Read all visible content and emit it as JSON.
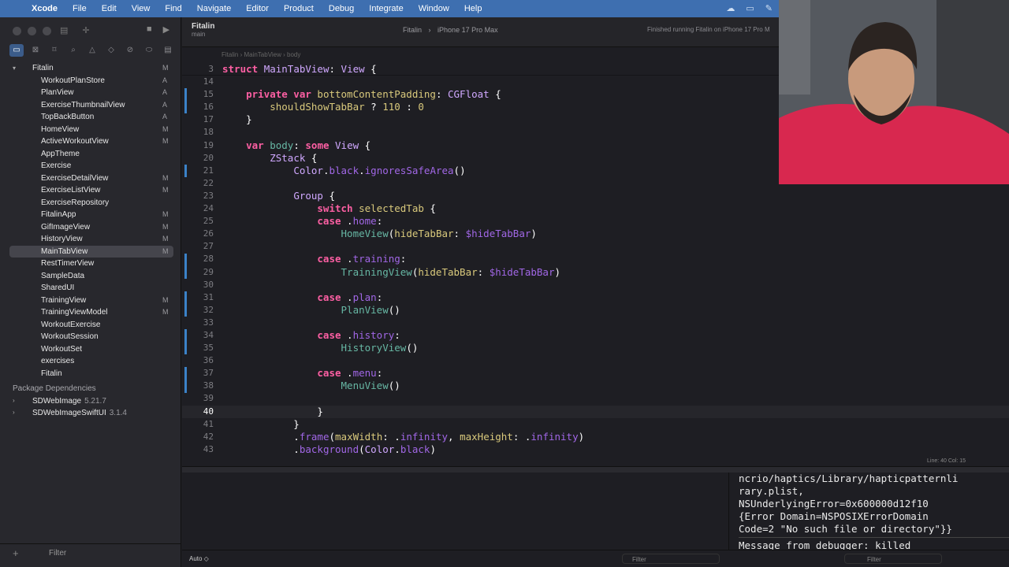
{
  "menubar": {
    "app": "Xcode",
    "items": [
      "File",
      "Edit",
      "View",
      "Find",
      "Navigate",
      "Editor",
      "Product",
      "Debug",
      "Integrate",
      "Window",
      "Help"
    ]
  },
  "toolbar": {
    "project": "Fitalin",
    "branch": "main",
    "scheme": "Fitalin",
    "destination": "iPhone 17 Pro Max",
    "status": "Finished running Fitalin on iPhone 17 Pro M"
  },
  "breadcrumb": [
    "Fitalin",
    "MainTabView",
    "body"
  ],
  "navigator": {
    "root": "Fitalin",
    "root_status": "M",
    "files": [
      {
        "name": "WorkoutPlanStore",
        "status": "A"
      },
      {
        "name": "PlanView",
        "status": "A"
      },
      {
        "name": "ExerciseThumbnailView",
        "status": "A"
      },
      {
        "name": "TopBackButton",
        "status": "A"
      },
      {
        "name": "HomeView",
        "status": "M"
      },
      {
        "name": "ActiveWorkoutView",
        "status": "M"
      },
      {
        "name": "AppTheme",
        "status": ""
      },
      {
        "name": "Exercise",
        "status": ""
      },
      {
        "name": "ExerciseDetailView",
        "status": "M"
      },
      {
        "name": "ExerciseListView",
        "status": "M"
      },
      {
        "name": "ExerciseRepository",
        "status": ""
      },
      {
        "name": "FitalinApp",
        "status": "M"
      },
      {
        "name": "GifImageView",
        "status": "M"
      },
      {
        "name": "HistoryView",
        "status": "M"
      },
      {
        "name": "MainTabView",
        "status": "M"
      },
      {
        "name": "RestTimerView",
        "status": ""
      },
      {
        "name": "SampleData",
        "status": ""
      },
      {
        "name": "SharedUI",
        "status": ""
      },
      {
        "name": "TrainingView",
        "status": "M"
      },
      {
        "name": "TrainingViewModel",
        "status": "M"
      },
      {
        "name": "WorkoutExercise",
        "status": ""
      },
      {
        "name": "WorkoutSession",
        "status": ""
      },
      {
        "name": "WorkoutSet",
        "status": ""
      },
      {
        "name": "exercises",
        "status": ""
      },
      {
        "name": "Fitalin",
        "status": ""
      }
    ],
    "packages_header": "Package Dependencies",
    "packages": [
      {
        "name": "SDWebImage",
        "version": "5.21.7"
      },
      {
        "name": "SDWebImageSwiftUI",
        "version": "3.1.4"
      }
    ],
    "filter_placeholder": "Filter"
  },
  "editor": {
    "sticky": {
      "num": "3",
      "parts": [
        [
          "kw",
          "struct "
        ],
        [
          "ty",
          "MainTabView"
        ],
        [
          "pl",
          ": "
        ],
        [
          "ty",
          "View"
        ],
        [
          "pl",
          " {"
        ]
      ]
    },
    "lines": [
      {
        "num": "14",
        "parts": []
      },
      {
        "num": "15",
        "parts": [
          [
            "kw",
            "    private var "
          ],
          [
            "nm2",
            "bottomContentPadding"
          ],
          [
            "pl",
            ": "
          ],
          [
            "ty",
            "CGFloat"
          ],
          [
            "pl",
            " {"
          ]
        ]
      },
      {
        "num": "16",
        "parts": [
          [
            "pl",
            "        "
          ],
          [
            "nm2",
            "shouldShowTabBar"
          ],
          [
            "pl",
            " ? "
          ],
          [
            "nm2",
            "110"
          ],
          [
            "pl",
            " : "
          ],
          [
            "nm2",
            "0"
          ]
        ]
      },
      {
        "num": "17",
        "parts": [
          [
            "pl",
            "    }"
          ]
        ]
      },
      {
        "num": "18",
        "parts": []
      },
      {
        "num": "19",
        "parts": [
          [
            "kw",
            "    var "
          ],
          [
            "fn",
            "body"
          ],
          [
            "pl",
            ": "
          ],
          [
            "kw",
            "some "
          ],
          [
            "ty",
            "View"
          ],
          [
            "pl",
            " {"
          ]
        ]
      },
      {
        "num": "20",
        "parts": [
          [
            "pl",
            "        "
          ],
          [
            "ty",
            "ZStack"
          ],
          [
            "pl",
            " {"
          ]
        ]
      },
      {
        "num": "21",
        "parts": [
          [
            "pl",
            "            "
          ],
          [
            "ty",
            "Color"
          ],
          [
            "pl",
            "."
          ],
          [
            "pr",
            "black"
          ],
          [
            "pl",
            "."
          ],
          [
            "pr",
            "ignoresSafeArea"
          ],
          [
            "pl",
            "()"
          ]
        ]
      },
      {
        "num": "22",
        "parts": []
      },
      {
        "num": "23",
        "parts": [
          [
            "pl",
            "            "
          ],
          [
            "ty",
            "Group"
          ],
          [
            "pl",
            " {"
          ]
        ]
      },
      {
        "num": "24",
        "parts": [
          [
            "kw",
            "                switch "
          ],
          [
            "nm2",
            "selectedTab"
          ],
          [
            "pl",
            " {"
          ]
        ]
      },
      {
        "num": "25",
        "parts": [
          [
            "kw",
            "                case "
          ],
          [
            "pl",
            "."
          ],
          [
            "pr",
            "home"
          ],
          [
            "pl",
            ":"
          ]
        ]
      },
      {
        "num": "26",
        "parts": [
          [
            "pl",
            "                    "
          ],
          [
            "fn",
            "HomeView"
          ],
          [
            "pl",
            "("
          ],
          [
            "nm2",
            "hideTabBar"
          ],
          [
            "pl",
            ": "
          ],
          [
            "pr",
            "$hideTabBar"
          ],
          [
            "pl",
            ")"
          ]
        ]
      },
      {
        "num": "27",
        "parts": []
      },
      {
        "num": "28",
        "parts": [
          [
            "kw",
            "                case "
          ],
          [
            "pl",
            "."
          ],
          [
            "pr",
            "training"
          ],
          [
            "pl",
            ":"
          ]
        ]
      },
      {
        "num": "29",
        "parts": [
          [
            "pl",
            "                    "
          ],
          [
            "fn",
            "TrainingView"
          ],
          [
            "pl",
            "("
          ],
          [
            "nm2",
            "hideTabBar"
          ],
          [
            "pl",
            ": "
          ],
          [
            "pr",
            "$hideTabBar"
          ],
          [
            "pl",
            ")"
          ]
        ]
      },
      {
        "num": "30",
        "parts": []
      },
      {
        "num": "31",
        "parts": [
          [
            "kw",
            "                case "
          ],
          [
            "pl",
            "."
          ],
          [
            "pr",
            "plan"
          ],
          [
            "pl",
            ":"
          ]
        ]
      },
      {
        "num": "32",
        "parts": [
          [
            "pl",
            "                    "
          ],
          [
            "fn",
            "PlanView"
          ],
          [
            "pl",
            "()"
          ]
        ]
      },
      {
        "num": "33",
        "parts": []
      },
      {
        "num": "34",
        "parts": [
          [
            "kw",
            "                case "
          ],
          [
            "pl",
            "."
          ],
          [
            "pr",
            "history"
          ],
          [
            "pl",
            ":"
          ]
        ]
      },
      {
        "num": "35",
        "parts": [
          [
            "pl",
            "                    "
          ],
          [
            "fn",
            "HistoryView"
          ],
          [
            "pl",
            "()"
          ]
        ]
      },
      {
        "num": "36",
        "parts": []
      },
      {
        "num": "37",
        "parts": [
          [
            "kw",
            "                case "
          ],
          [
            "pl",
            "."
          ],
          [
            "pr",
            "menu"
          ],
          [
            "pl",
            ":"
          ]
        ]
      },
      {
        "num": "38",
        "parts": [
          [
            "pl",
            "                    "
          ],
          [
            "fn",
            "MenuView"
          ],
          [
            "pl",
            "()"
          ]
        ]
      },
      {
        "num": "39",
        "parts": []
      },
      {
        "num": "40",
        "parts": [
          [
            "pl",
            "                }"
          ]
        ],
        "current": true
      },
      {
        "num": "41",
        "parts": [
          [
            "pl",
            "            }"
          ]
        ]
      },
      {
        "num": "42",
        "parts": [
          [
            "pl",
            "            ."
          ],
          [
            "pr",
            "frame"
          ],
          [
            "pl",
            "("
          ],
          [
            "nm2",
            "maxWidth"
          ],
          [
            "pl",
            ": ."
          ],
          [
            "pr",
            "infinity"
          ],
          [
            "pl",
            ", "
          ],
          [
            "nm2",
            "maxHeight"
          ],
          [
            "pl",
            ": ."
          ],
          [
            "pr",
            "infinity"
          ],
          [
            "pl",
            ")"
          ]
        ]
      },
      {
        "num": "43",
        "parts": [
          [
            "pl",
            "            ."
          ],
          [
            "pr",
            "background"
          ],
          [
            "pl",
            "("
          ],
          [
            "ty",
            "Color"
          ],
          [
            "pl",
            "."
          ],
          [
            "pr",
            "black"
          ],
          [
            "pl",
            ")"
          ]
        ]
      }
    ],
    "cursor_position": "Line: 40  Col: 15"
  },
  "console": {
    "lines": [
      "ncrio/haptics/Library/hapticpatternli",
      "rary.plist,",
      "NSUnderlyingError=0x600000d12f10",
      "{Error Domain=NSPOSIXErrorDomain",
      "Code=2 \"No such file or directory\"}}"
    ],
    "message": "Message from debugger: killed"
  },
  "debug_bar": {
    "auto": "Auto ◇",
    "filter_left": "Filter",
    "filter_right": "Filter"
  }
}
